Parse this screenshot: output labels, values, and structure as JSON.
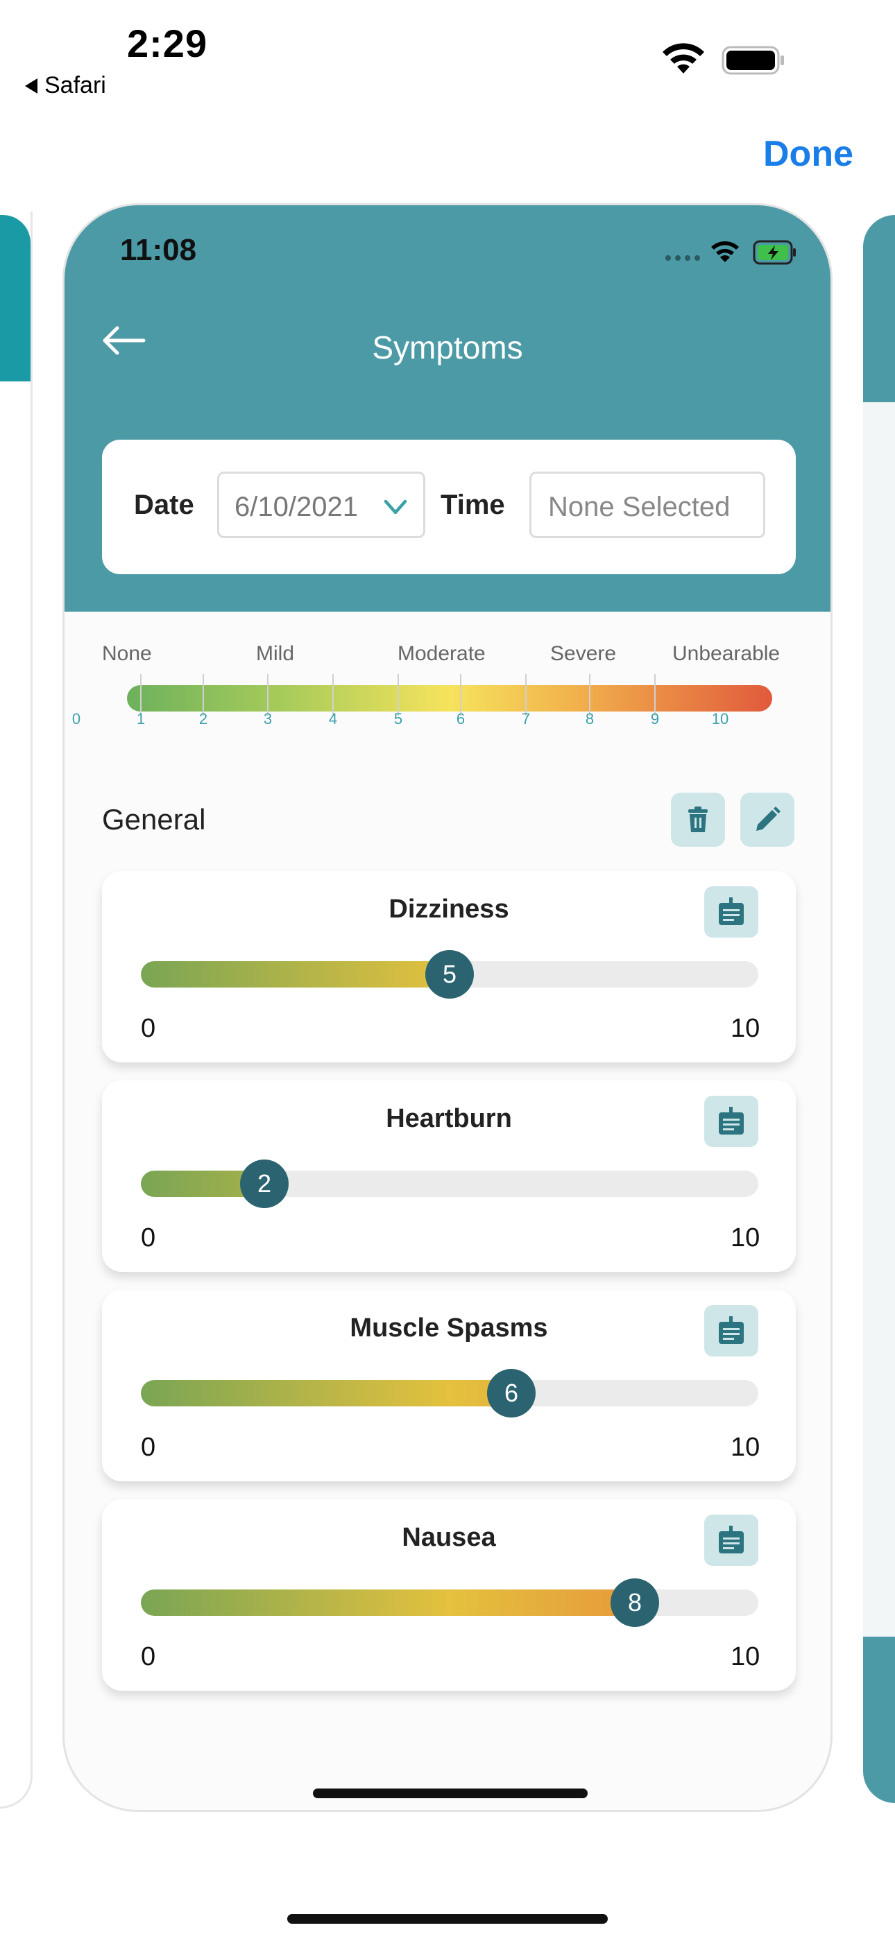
{
  "os": {
    "time": "2:29",
    "back_label": "Safari",
    "done_label": "Done"
  },
  "app": {
    "status_time": "11:08",
    "title": "Symptoms",
    "date_label": "Date",
    "date_value": "6/10/2021",
    "time_label": "Time",
    "time_placeholder": "None Selected"
  },
  "scale": {
    "words": [
      "None",
      "Mild",
      "Moderate",
      "Severe",
      "Unbearable"
    ],
    "numbers": [
      "0",
      "1",
      "2",
      "3",
      "4",
      "5",
      "6",
      "7",
      "8",
      "9",
      "10"
    ]
  },
  "section": {
    "title": "General"
  },
  "symptoms": [
    {
      "name": "Dizziness",
      "value": 5,
      "value_label": "5",
      "min": "0",
      "max": "10"
    },
    {
      "name": "Heartburn",
      "value": 2,
      "value_label": "2",
      "min": "0",
      "max": "10"
    },
    {
      "name": "Muscle Spasms",
      "value": 6,
      "value_label": "6",
      "min": "0",
      "max": "10"
    },
    {
      "name": "Nausea",
      "value": 8,
      "value_label": "8",
      "min": "0",
      "max": "10"
    }
  ],
  "colors": {
    "header": "#4c9aa6",
    "accent": "#1a7ee8",
    "knob": "#2b6470",
    "button_bg": "#cfe6e8"
  }
}
